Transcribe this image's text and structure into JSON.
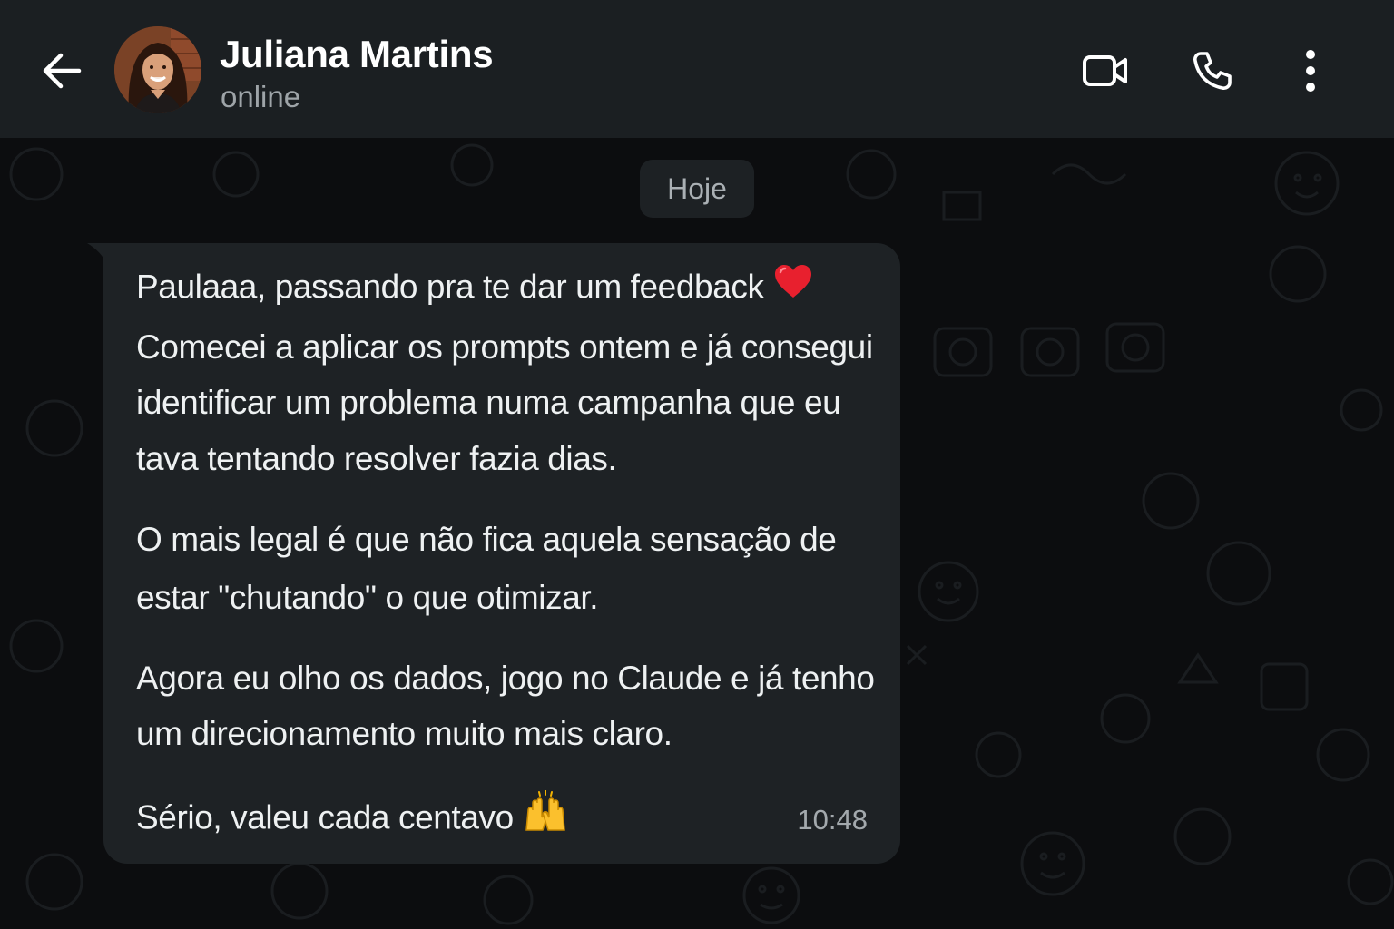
{
  "header": {
    "contact_name": "Juliana Martins",
    "status": "online",
    "icons": {
      "back": "arrow-left-icon",
      "video": "video-camera-icon",
      "call": "phone-icon",
      "menu": "more-vertical-icon"
    }
  },
  "chat": {
    "date_separator": "Hoje",
    "message": {
      "lines": [
        "Paulaaa, passando pra te dar um feedback",
        "Comecei a aplicar os prompts ontem e já consegui",
        "identificar um problema numa campanha que eu",
        "tava tentando resolver fazia dias.",
        "O mais legal é que não fica aquela sensação de",
        "estar \"chutando\" o que otimizar.",
        "Agora eu olho os dados, jogo no Claude e já tenho",
        "um direcionamento muito mais claro.",
        "Sério, valeu cada centavo"
      ],
      "emojis": {
        "first_line": "red-heart-emoji",
        "last_line": "raising-hands-emoji"
      },
      "time": "10:48"
    }
  },
  "colors": {
    "header_bg": "#1b1f22",
    "chat_bg": "#0c0d0f",
    "bubble_bg": "#1e2225",
    "text_primary": "#eef1f2",
    "text_secondary": "#9ea4a8"
  }
}
